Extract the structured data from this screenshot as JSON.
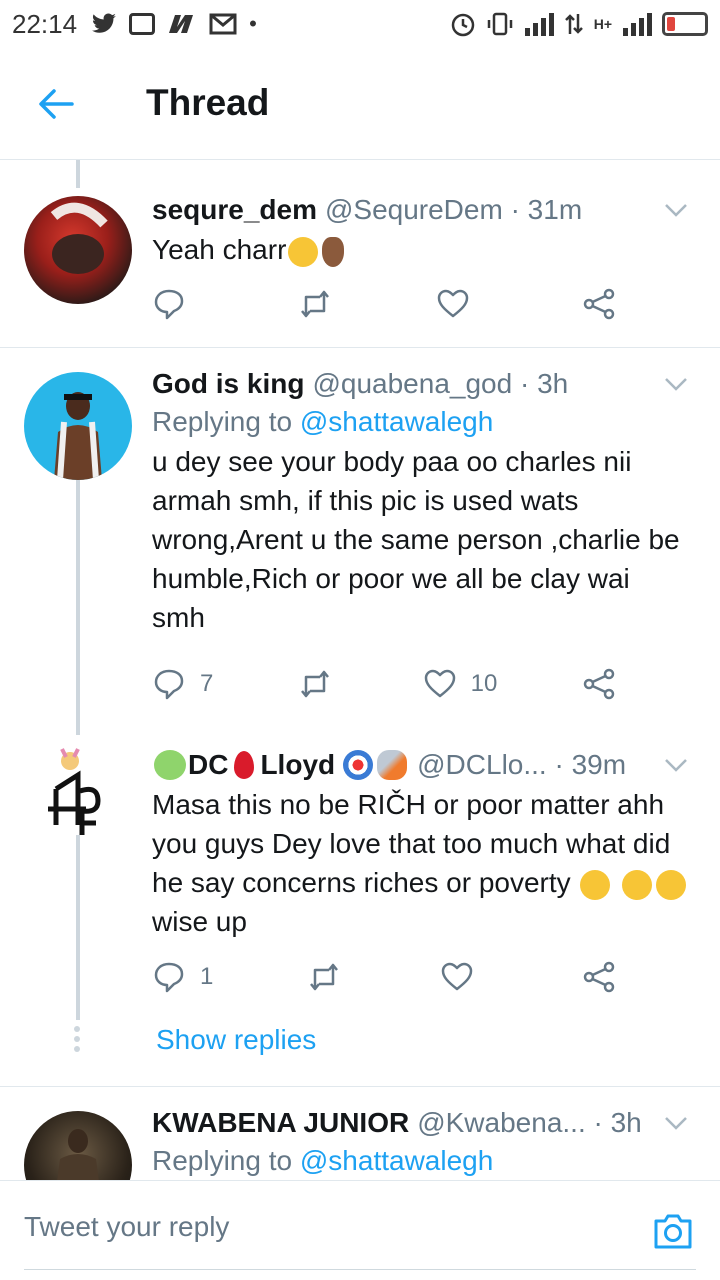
{
  "status_bar": {
    "time": "22:14",
    "network": "H+"
  },
  "header": {
    "title": "Thread"
  },
  "tweets": [
    {
      "name": "sequre_dem",
      "handle": "@SequreDem · 31m",
      "text": "Yeah charr",
      "reply_count": "",
      "like_count": ""
    },
    {
      "name": "God is king",
      "handle": "@quabena_god · 3h",
      "replying_label": "Replying to",
      "replying_to": "@shattawalegh",
      "text": "u dey see your body paa oo charles nii armah smh, if this pic is used wats wrong,Arent u the same person ,charlie be humble,Rich or poor we all be clay wai smh",
      "reply_count": "7",
      "like_count": "10"
    },
    {
      "name_a": "DC",
      "name_b": "Lloyd",
      "handle": "@DCLlo... · 39m",
      "text_a": "Masa this no be RIČH or poor matter ahh you guys Dey love that too much what did he say concerns riches or poverty",
      "text_b": "wise up",
      "reply_count": "1",
      "like_count": ""
    },
    {
      "name": "KWABENA JUNIOR",
      "handle": "@Kwabena... · 3h",
      "replying_label": "Replying to",
      "replying_to": "@shattawalegh"
    }
  ],
  "show_replies": "Show replies",
  "reply_bar": {
    "placeholder": "Tweet your reply"
  },
  "colors": {
    "accent": "#1da1f2",
    "muted": "#657786",
    "text": "#14171a"
  }
}
